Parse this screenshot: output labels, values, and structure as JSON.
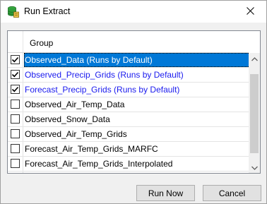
{
  "window": {
    "title": "Run Extract"
  },
  "grid": {
    "column_header": "Group",
    "rows": [
      {
        "label": "Observed_Data (Runs by Default)",
        "checked": true,
        "selected": true,
        "blue": false
      },
      {
        "label": "Observed_Precip_Grids (Runs by Default)",
        "checked": true,
        "selected": false,
        "blue": true
      },
      {
        "label": "Forecast_Precip_Grids (Runs by Default)",
        "checked": true,
        "selected": false,
        "blue": true
      },
      {
        "label": "Observed_Air_Temp_Data",
        "checked": false,
        "selected": false,
        "blue": false
      },
      {
        "label": "Observed_Snow_Data",
        "checked": false,
        "selected": false,
        "blue": false
      },
      {
        "label": "Observed_Air_Temp_Grids",
        "checked": false,
        "selected": false,
        "blue": false
      },
      {
        "label": "Forecast_Air_Temp_Grids_MARFC",
        "checked": false,
        "selected": false,
        "blue": false
      },
      {
        "label": "Forecast_Air_Temp_Grids_Interpolated",
        "checked": false,
        "selected": false,
        "blue": false
      }
    ]
  },
  "buttons": {
    "run_now": "Run Now",
    "cancel": "Cancel"
  },
  "colors": {
    "selection": "#0078d7",
    "default_group_text": "#1a1aee"
  }
}
